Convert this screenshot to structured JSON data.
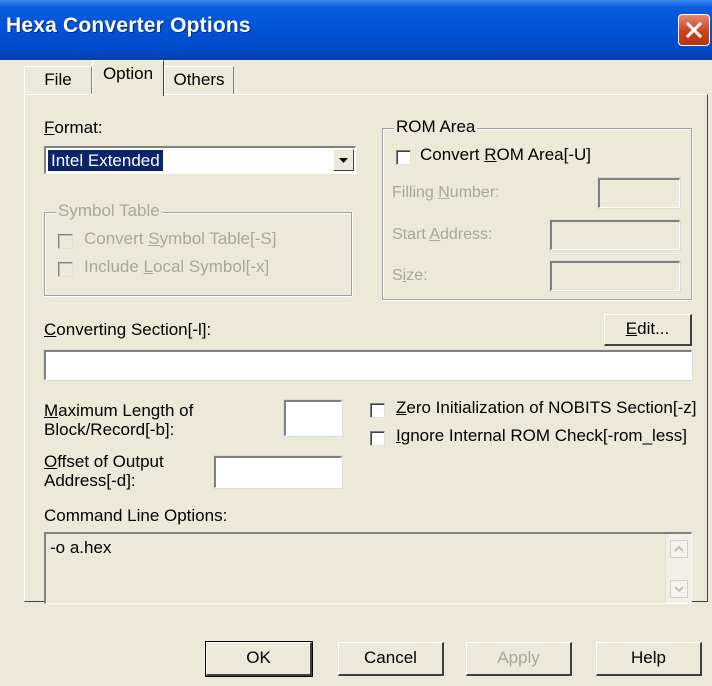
{
  "window": {
    "title": "Hexa Converter Options"
  },
  "tabs": [
    {
      "label": "File"
    },
    {
      "label": "Option"
    },
    {
      "label": "Others"
    }
  ],
  "format": {
    "label_pre": "",
    "label_u": "F",
    "label_post": "ormat:",
    "selected": "Intel Extended"
  },
  "symbol_table": {
    "title": "Symbol Table",
    "convert": {
      "pre": "Convert ",
      "u": "S",
      "post": "ymbol Table[-S]"
    },
    "include": {
      "pre": "Include ",
      "u": "L",
      "post": "ocal Symbol[-x]"
    }
  },
  "rom_area": {
    "title": "ROM Area",
    "convert": {
      "pre": "Convert ",
      "u": "R",
      "post": "OM Area[-U]"
    },
    "filling": {
      "pre": "Filling ",
      "u": "N",
      "post": "umber:"
    },
    "start": {
      "pre": "Start ",
      "u": "A",
      "post": "ddress:"
    },
    "size": {
      "pre": "S",
      "u": "i",
      "post": "ze:"
    }
  },
  "converting_section": {
    "pre": "",
    "u": "C",
    "post": "onverting Section[-l]:",
    "value": ""
  },
  "edit_button": {
    "pre": "",
    "u": "E",
    "post": "dit..."
  },
  "max_length": {
    "line1_u": "M",
    "line1_post": "aximum Length of",
    "line2": "Block/Record[-b]:",
    "value": ""
  },
  "offset": {
    "line1_u": "O",
    "line1_post": "ffset of Output",
    "line2": "Address[-d]:",
    "value": ""
  },
  "zero_init": {
    "u": "Z",
    "post": "ero Initialization of NOBITS Section[-z]"
  },
  "ignore_rom": {
    "u": "I",
    "post": "gnore Internal ROM Check[-rom_less]"
  },
  "command_line": {
    "label": "Command Line Options:",
    "value": "-o a.hex"
  },
  "buttons": {
    "ok": "OK",
    "cancel": "Cancel",
    "apply": "Apply",
    "help": "Help"
  }
}
